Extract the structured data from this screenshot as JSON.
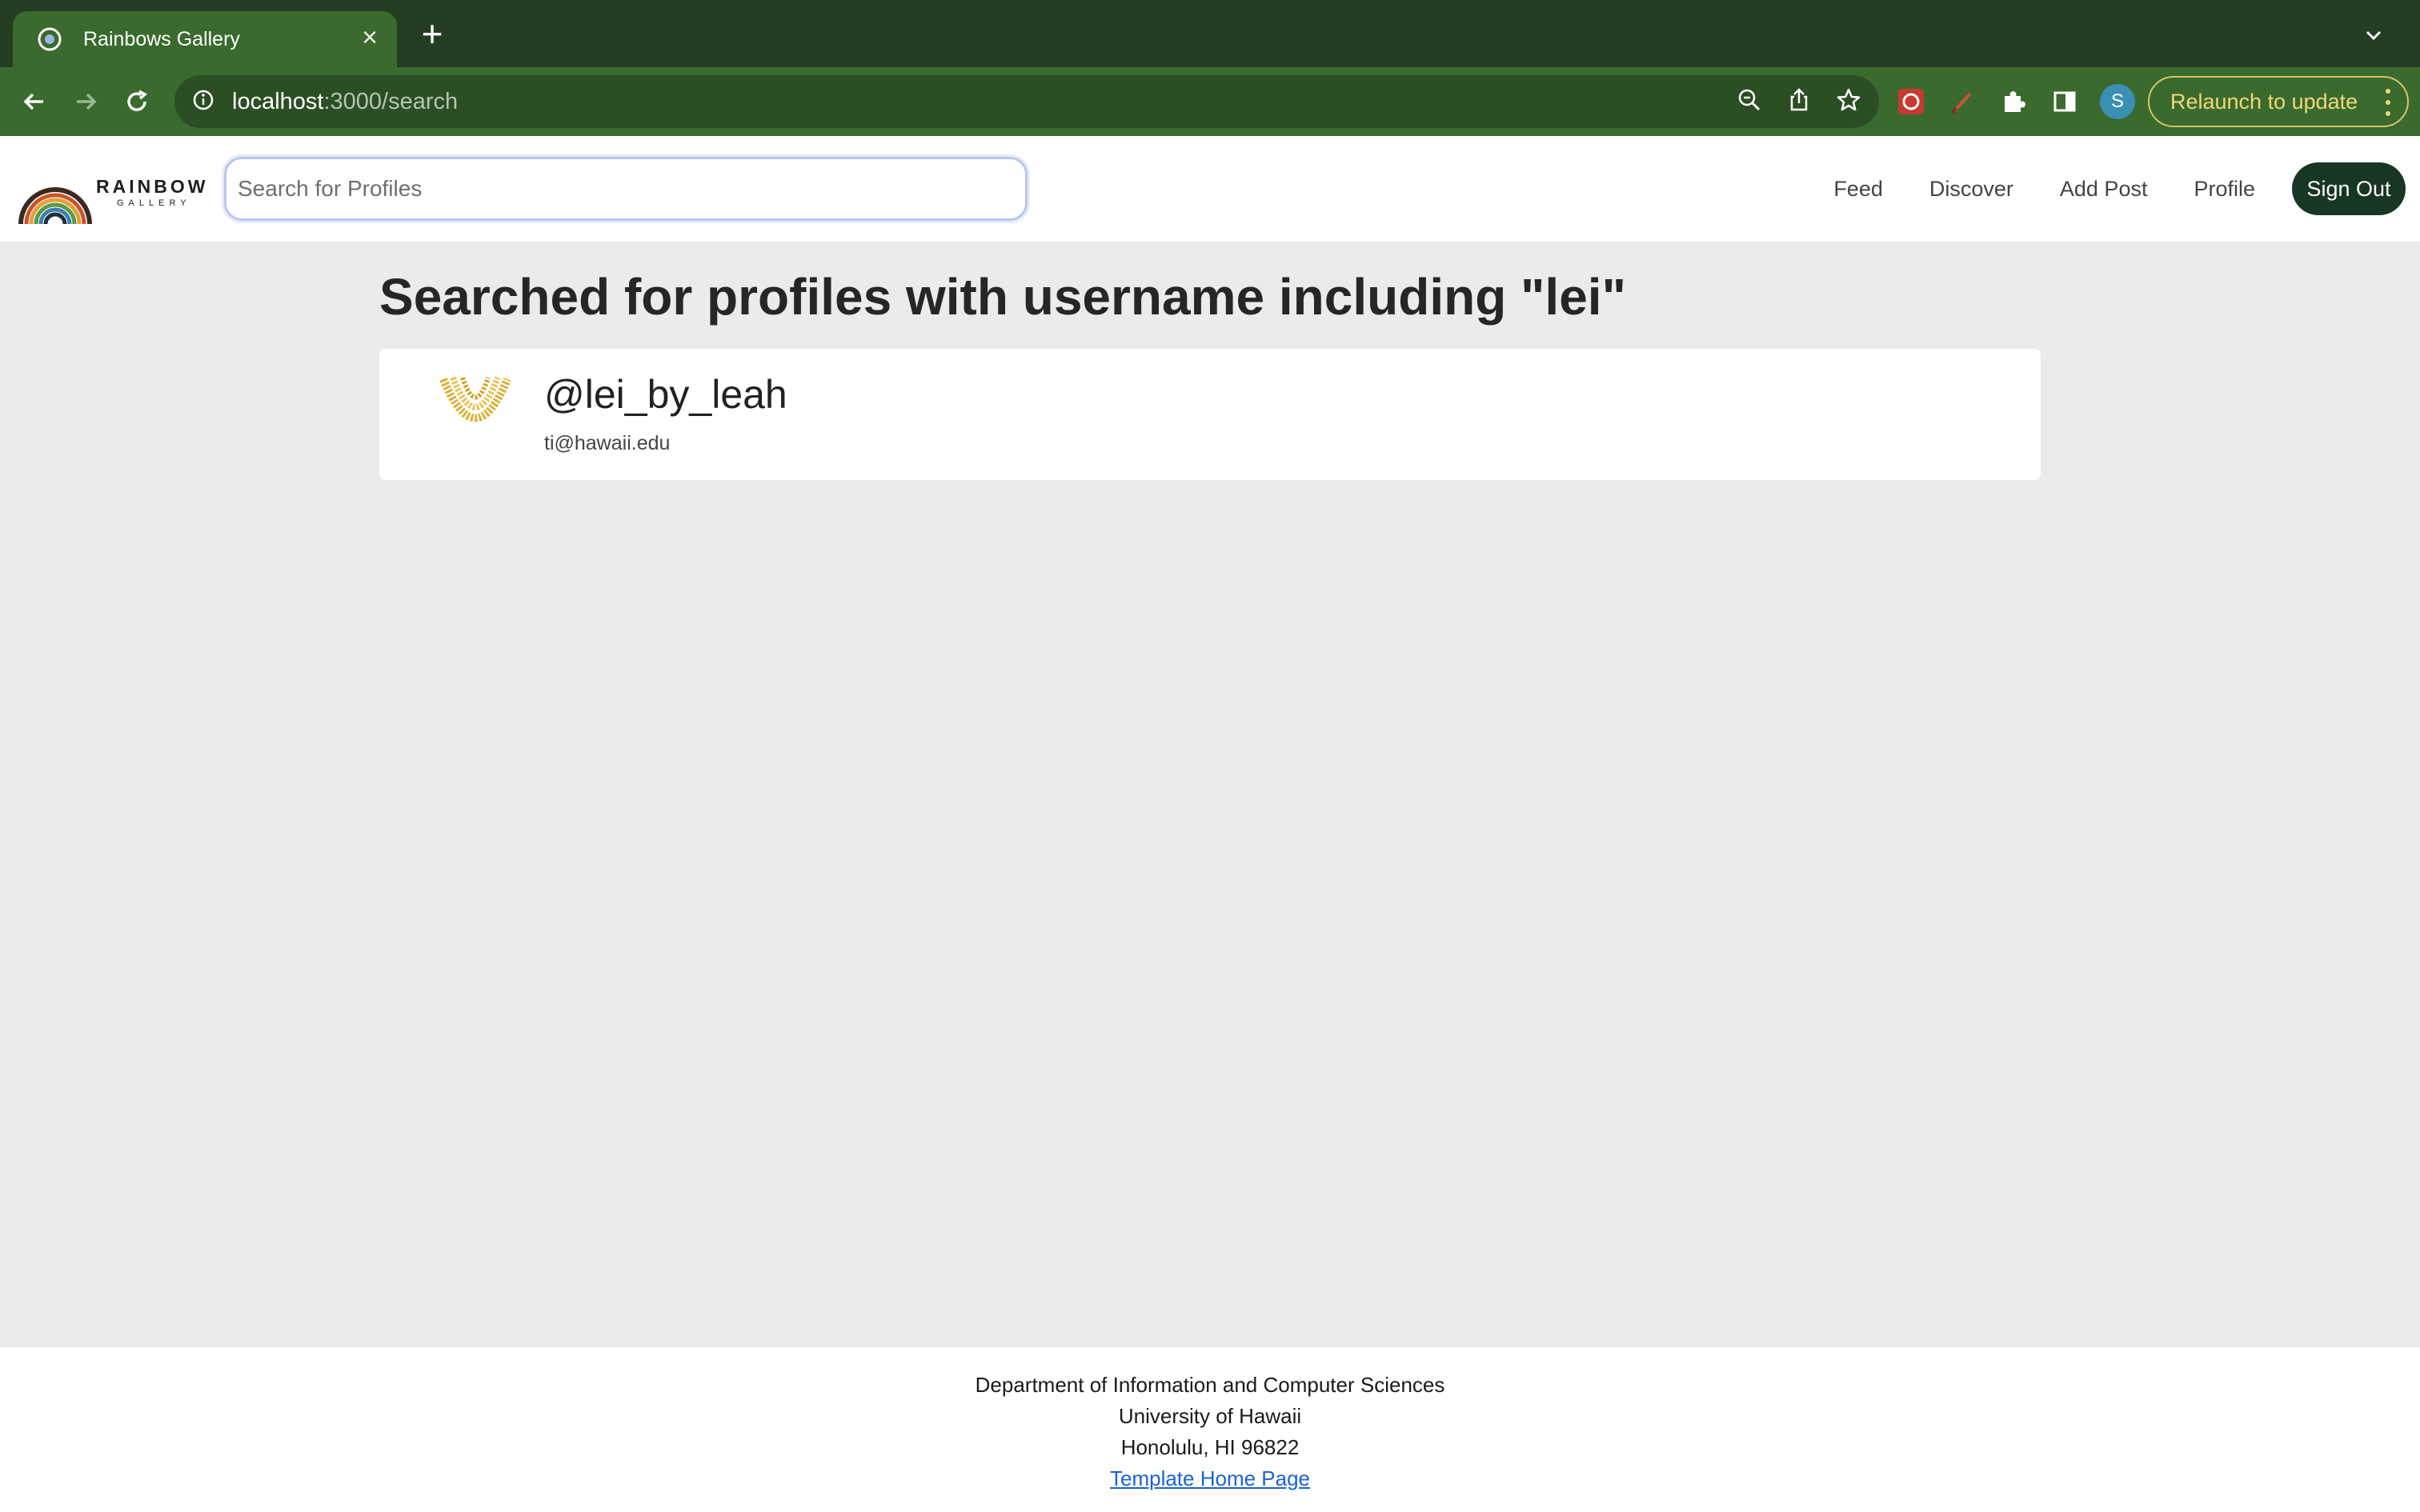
{
  "browser": {
    "tab_title": "Rainbows Gallery",
    "url_host": "localhost",
    "url_path": ":3000/search",
    "profile_initial": "S",
    "relaunch_label": "Relaunch to update"
  },
  "navbar": {
    "logo_word": "RAINBOW",
    "logo_sub": "GALLERY",
    "search_placeholder": "Search for Profiles",
    "links": [
      "Feed",
      "Discover",
      "Add Post",
      "Profile"
    ],
    "signout_label": "Sign Out"
  },
  "main": {
    "heading": "Searched for profiles with username including \"lei\"",
    "results": [
      {
        "username": "@lei_by_leah",
        "email": "ti@hawaii.edu"
      }
    ]
  },
  "footer": {
    "line1": "Department of Information and Computer Sciences",
    "line2": "University of Hawaii",
    "line3": "Honolulu, HI 96822",
    "link_label": "Template Home Page"
  }
}
